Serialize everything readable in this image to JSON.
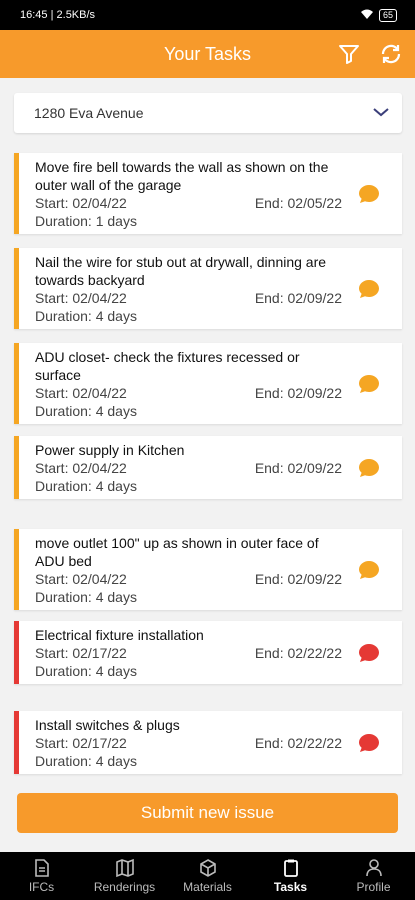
{
  "status_bar": {
    "time": "16:45",
    "speed": "2.5KB/s",
    "battery": "65"
  },
  "header": {
    "title": "Your Tasks",
    "filter_icon": "filter-icon",
    "refresh_icon": "refresh-icon"
  },
  "project_selector": {
    "value": "1280 Eva Avenue"
  },
  "tasks": [
    {
      "title": "Move fire bell towards the wall as shown on the outer wall of the garage",
      "start": "Start: 02/04/22",
      "end": "End: 02/05/22",
      "duration": "Duration: 1 days",
      "status_color": "#f5a623"
    },
    {
      "title": "Nail the wire for stub out at drywall, dinning are towards backyard",
      "start": "Start: 02/04/22",
      "end": "End: 02/09/22",
      "duration": "Duration: 4 days",
      "status_color": "#f5a623"
    },
    {
      "title": "ADU closet- check the fixtures recessed or surface",
      "start": "Start: 02/04/22",
      "end": "End: 02/09/22",
      "duration": "Duration: 4 days",
      "status_color": "#f5a623"
    },
    {
      "title": "Power supply in Kitchen",
      "start": "Start: 02/04/22",
      "end": "End: 02/09/22",
      "duration": "Duration: 4 days",
      "status_color": "#f5a623"
    },
    {
      "title": "move outlet 100\" up as shown in outer face of ADU bed",
      "start": "Start: 02/04/22",
      "end": "End: 02/09/22",
      "duration": "Duration: 4 days",
      "status_color": "#f5a623"
    },
    {
      "title": "Electrical fixture installation",
      "start": "Start: 02/17/22",
      "end": "End: 02/22/22",
      "duration": "Duration: 4 days",
      "status_color": "#e53935"
    },
    {
      "title": "Install switches & plugs",
      "start": "Start: 02/17/22",
      "end": "End: 02/22/22",
      "duration": "Duration: 4 days",
      "status_color": "#e53935"
    }
  ],
  "submit_button": {
    "label": "Submit new issue"
  },
  "bottom_nav": [
    {
      "label": "IFCs",
      "icon": "document-icon"
    },
    {
      "label": "Renderings",
      "icon": "map-icon"
    },
    {
      "label": "Materials",
      "icon": "box-icon"
    },
    {
      "label": "Tasks",
      "icon": "clipboard-icon",
      "active": true
    },
    {
      "label": "Profile",
      "icon": "person-icon"
    }
  ],
  "colors": {
    "accent": "#f79a2b",
    "pending": "#f5a623",
    "overdue": "#e53935"
  }
}
